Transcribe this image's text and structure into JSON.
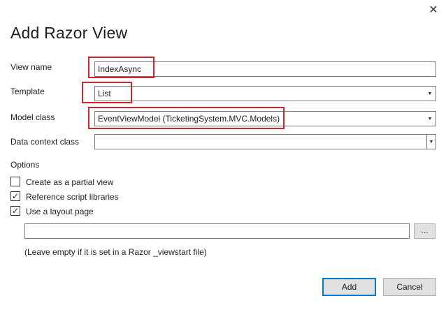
{
  "dialog": {
    "title": "Add Razor View",
    "close_glyph": "✕"
  },
  "fields": {
    "view_name": {
      "label": "View name",
      "value": "IndexAsync"
    },
    "template": {
      "label": "Template",
      "value": "List"
    },
    "model_class": {
      "label": "Model class",
      "value": "EventViewModel (TicketingSystem.MVC.Models)"
    },
    "data_context_class": {
      "label": "Data context class",
      "value": ""
    }
  },
  "options": {
    "heading": "Options",
    "partial_view": {
      "label": "Create as a partial view",
      "checked": false
    },
    "script_libraries": {
      "label": "Reference script libraries",
      "checked": true
    },
    "layout_page": {
      "label": "Use a layout page",
      "checked": true
    },
    "layout_path": {
      "value": "",
      "browse_label": "..."
    },
    "hint": "(Leave empty if it is set in a Razor _viewstart file)"
  },
  "buttons": {
    "add": "Add",
    "cancel": "Cancel"
  },
  "icons": {
    "dropdown": "▼",
    "check": "✓"
  },
  "colors": {
    "highlight": "#d2232f",
    "primary_border": "#0078d4"
  }
}
